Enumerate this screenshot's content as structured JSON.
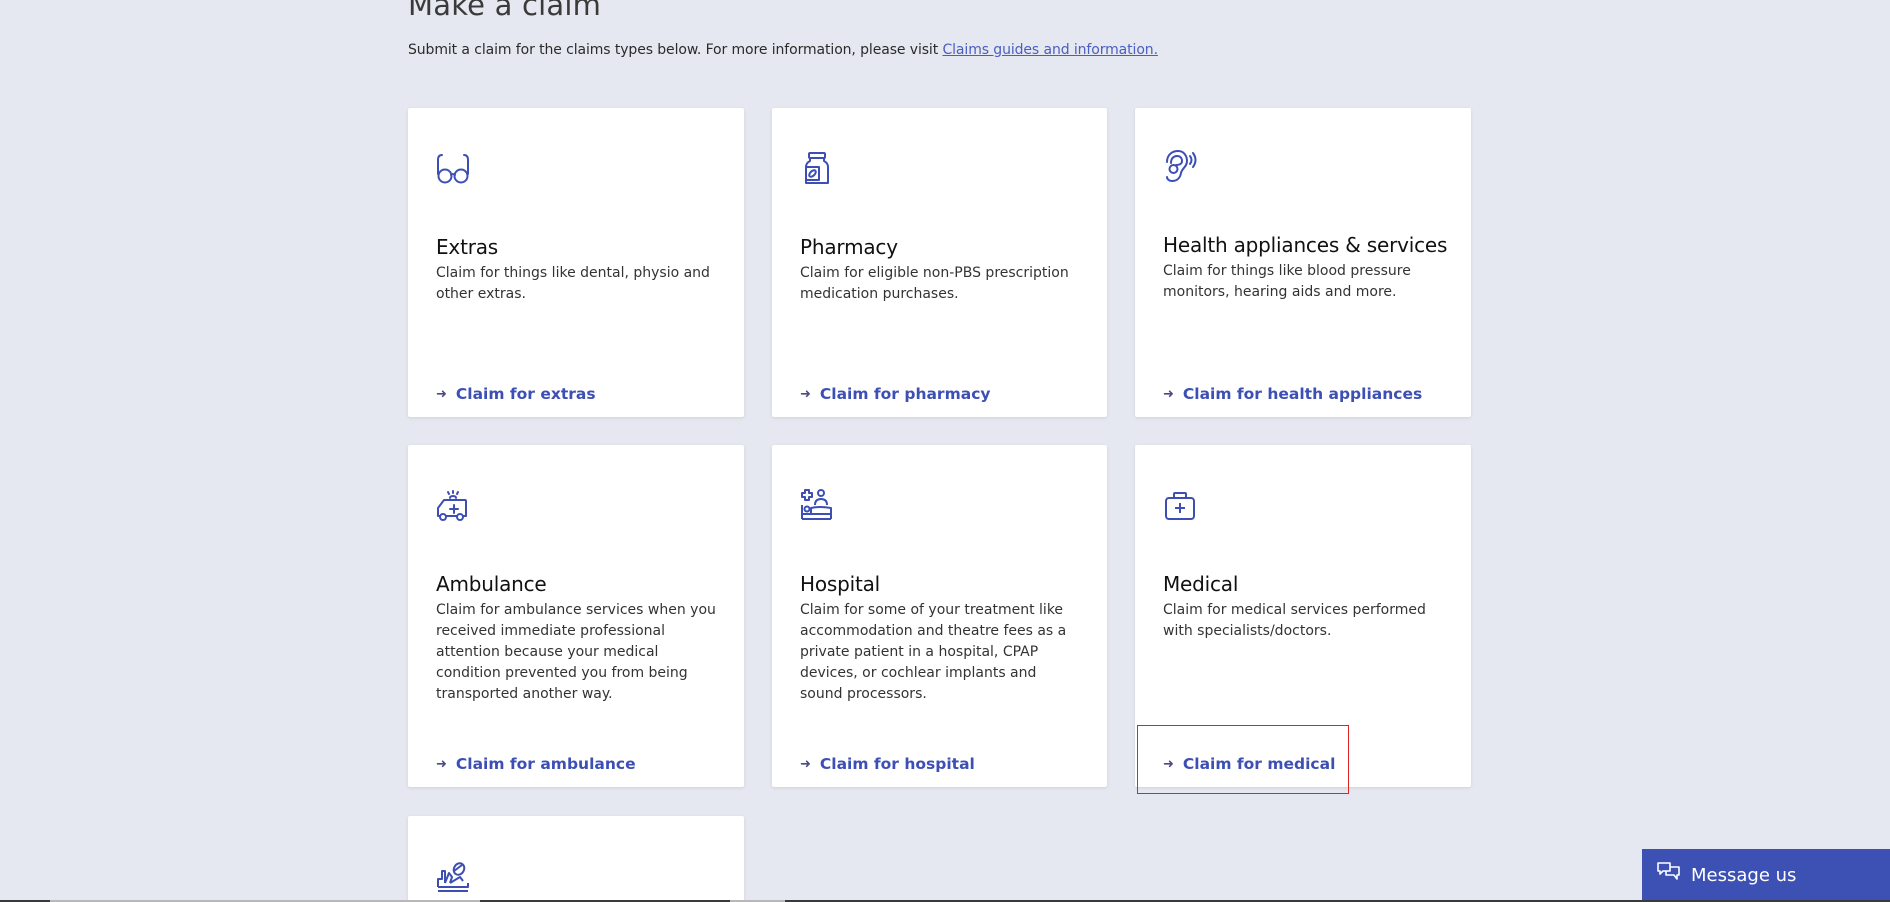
{
  "page": {
    "heading": "Make a claim",
    "intro_text": "Submit a claim for the claims types below. For more information, please visit ",
    "intro_link": "Claims guides and information."
  },
  "colors": {
    "background": "#e5e8f0",
    "card": "#ffffff",
    "accent": "#3d4fb5",
    "message_button": "#3d51b4",
    "highlight": "#e02424"
  },
  "cards": [
    {
      "icon": "glasses-icon",
      "title": "Extras",
      "description": "Claim for things like dental, physio and other extras.",
      "cta": "Claim for extras"
    },
    {
      "icon": "medicine-bottle-icon",
      "title": "Pharmacy",
      "description": "Claim for eligible non-PBS prescription medication purchases.",
      "cta": "Claim for pharmacy"
    },
    {
      "icon": "hearing-icon",
      "title": "Health appliances & services",
      "description": "Claim for things like blood pressure monitors, hearing aids and more.",
      "cta": "Claim for health appliances"
    },
    {
      "icon": "ambulance-icon",
      "title": "Ambulance",
      "description": "Claim for ambulance services when you received immediate professional attention because your medical condition prevented you from being transported another way.",
      "cta": "Claim for ambulance"
    },
    {
      "icon": "hospital-bed-icon",
      "title": "Hospital",
      "description": "Claim for some of your treatment like accommodation and theatre fees as a private patient in a hospital, CPAP devices, or cochlear implants and sound processors.",
      "cta": "Claim for hospital"
    },
    {
      "icon": "medical-kit-icon",
      "title": "Medical",
      "description": "Claim for medical services performed with specialists/doctors.",
      "cta": "Claim for medical"
    },
    {
      "icon": "hand-care-icon"
    }
  ],
  "arrow_glyph": "➜",
  "message_button": {
    "icon": "chat-bubbles-icon",
    "label": "Message us"
  }
}
